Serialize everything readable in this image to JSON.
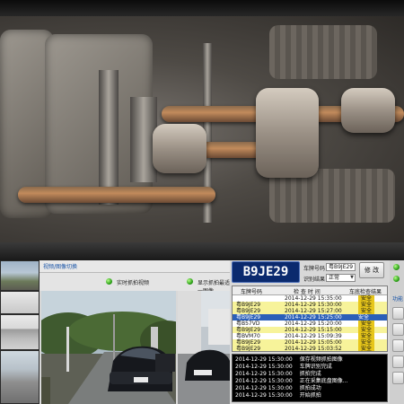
{
  "header": {
    "tab_label": "视频/图像切换"
  },
  "radios": [
    {
      "label": "实时抓拍视频"
    },
    {
      "label": "显示抓拍最适一图像"
    }
  ],
  "plate_display": "B9JE29",
  "fields": {
    "plate_label": "车牌号码：",
    "plate_value": "粤B9JE29",
    "result_label": "识别结果：",
    "result_value": "正常"
  },
  "fix_button": "修 改",
  "side_label": "功能",
  "table": {
    "headers": [
      "车牌号码",
      "检 查 时 间",
      "车底检查结果"
    ],
    "rows": [
      {
        "plate": "",
        "time": "2014-12-29 15:35:00",
        "result": "安全",
        "highlight": "none"
      },
      {
        "plate": "粤B9JE29",
        "time": "2014-12-29 15:30:00",
        "result": "安全",
        "highlight": "yellow"
      },
      {
        "plate": "粤B9JE29",
        "time": "2014-12-29 15:27:00",
        "result": "安全",
        "highlight": "yellow"
      },
      {
        "plate": "粤B9JE29",
        "time": "2014-12-29 15:25:00",
        "result": "安全",
        "highlight": "selected"
      },
      {
        "plate": "粤B57VD",
        "time": "2014-12-29 15:20:00",
        "result": "安全",
        "highlight": "none"
      },
      {
        "plate": "粤B9JE29",
        "time": "2014-12-29 15:15:00",
        "result": "安全",
        "highlight": "yellow"
      },
      {
        "plate": "粤BVM70",
        "time": "2014-12-29 15:09:39",
        "result": "安全",
        "highlight": "none"
      },
      {
        "plate": "粤B9JE29",
        "time": "2014-12-29 15:05:00",
        "result": "安全",
        "highlight": "yellow"
      },
      {
        "plate": "粤B9JE29",
        "time": "2014-12-29 15:03:52",
        "result": "安全",
        "highlight": "yellow"
      }
    ]
  },
  "log": [
    {
      "time": "2014-12-29 15:30:00",
      "msg": "保存视频抓拍图像"
    },
    {
      "time": "2014-12-29 15:30:00",
      "msg": "车牌识别完成"
    },
    {
      "time": "2014-12-29 15:30:00",
      "msg": "抓拍完成"
    },
    {
      "time": "2014-12-29 15:30:00",
      "msg": "正在采集底盘图像..."
    },
    {
      "time": "2014-12-29 15:30:00",
      "msg": "抓拍成功"
    },
    {
      "time": "2014-12-29 15:30:00",
      "msg": "开始抓拍"
    }
  ],
  "camera_plate": "粤B9JE29",
  "colors": {
    "highlight_yellow": "#f7f39a",
    "selected_blue": "#2b5fb8",
    "result_yellow": "#e7c61a"
  }
}
